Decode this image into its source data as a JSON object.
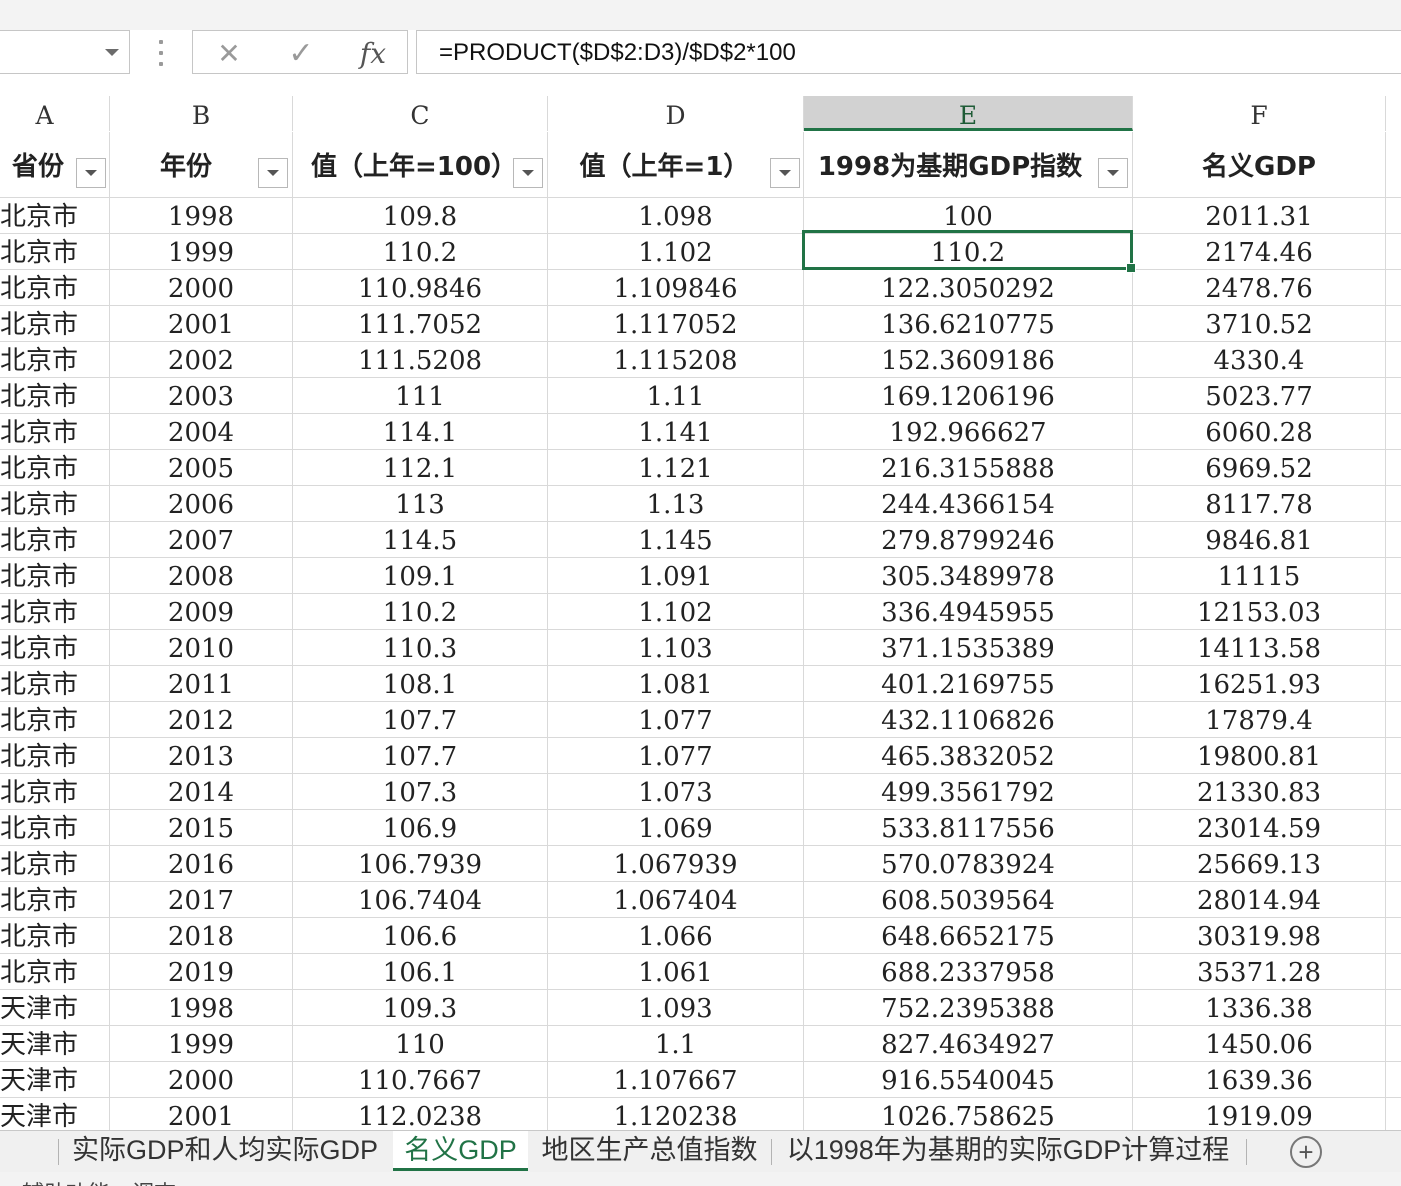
{
  "ribbon": {
    "labels": [
      "",
      "",
      "",
      ""
    ]
  },
  "formula_bar": {
    "name_box": "",
    "cancel_icon": "✕",
    "enter_icon": "✓",
    "fx_label": "fx",
    "formula": "=PRODUCT($D$2:D3)/$D$2*100"
  },
  "columns": [
    "A",
    "B",
    "C",
    "D",
    "E",
    "F"
  ],
  "selected_column": "E",
  "headers": [
    "省份",
    "年份",
    "值（上年=100）",
    "值（上年=1）",
    "1998为基期GDP指数",
    "名义GDP"
  ],
  "rows": [
    [
      "北京市",
      "1998",
      "109.8",
      "1.098",
      "100",
      "2011.31"
    ],
    [
      "北京市",
      "1999",
      "110.2",
      "1.102",
      "110.2",
      "2174.46"
    ],
    [
      "北京市",
      "2000",
      "110.9846",
      "1.109846",
      "122.3050292",
      "2478.76"
    ],
    [
      "北京市",
      "2001",
      "111.7052",
      "1.117052",
      "136.6210775",
      "3710.52"
    ],
    [
      "北京市",
      "2002",
      "111.5208",
      "1.115208",
      "152.3609186",
      "4330.4"
    ],
    [
      "北京市",
      "2003",
      "111",
      "1.11",
      "169.1206196",
      "5023.77"
    ],
    [
      "北京市",
      "2004",
      "114.1",
      "1.141",
      "192.966627",
      "6060.28"
    ],
    [
      "北京市",
      "2005",
      "112.1",
      "1.121",
      "216.3155888",
      "6969.52"
    ],
    [
      "北京市",
      "2006",
      "113",
      "1.13",
      "244.4366154",
      "8117.78"
    ],
    [
      "北京市",
      "2007",
      "114.5",
      "1.145",
      "279.8799246",
      "9846.81"
    ],
    [
      "北京市",
      "2008",
      "109.1",
      "1.091",
      "305.3489978",
      "11115"
    ],
    [
      "北京市",
      "2009",
      "110.2",
      "1.102",
      "336.4945955",
      "12153.03"
    ],
    [
      "北京市",
      "2010",
      "110.3",
      "1.103",
      "371.1535389",
      "14113.58"
    ],
    [
      "北京市",
      "2011",
      "108.1",
      "1.081",
      "401.2169755",
      "16251.93"
    ],
    [
      "北京市",
      "2012",
      "107.7",
      "1.077",
      "432.1106826",
      "17879.4"
    ],
    [
      "北京市",
      "2013",
      "107.7",
      "1.077",
      "465.3832052",
      "19800.81"
    ],
    [
      "北京市",
      "2014",
      "107.3",
      "1.073",
      "499.3561792",
      "21330.83"
    ],
    [
      "北京市",
      "2015",
      "106.9",
      "1.069",
      "533.8117556",
      "23014.59"
    ],
    [
      "北京市",
      "2016",
      "106.7939",
      "1.067939",
      "570.0783924",
      "25669.13"
    ],
    [
      "北京市",
      "2017",
      "106.7404",
      "1.067404",
      "608.5039564",
      "28014.94"
    ],
    [
      "北京市",
      "2018",
      "106.6",
      "1.066",
      "648.6652175",
      "30319.98"
    ],
    [
      "北京市",
      "2019",
      "106.1",
      "1.061",
      "688.2337958",
      "35371.28"
    ],
    [
      "天津市",
      "1998",
      "109.3",
      "1.093",
      "752.2395388",
      "1336.38"
    ],
    [
      "天津市",
      "1999",
      "110",
      "1.1",
      "827.4634927",
      "1450.06"
    ],
    [
      "天津市",
      "2000",
      "110.7667",
      "1.107667",
      "916.5540045",
      "1639.36"
    ],
    [
      "天津市",
      "2001",
      "112.0238",
      "1.120238",
      "1026.758625",
      "1919.09"
    ]
  ],
  "active_cell": {
    "ref": "E3",
    "value": "110.2"
  },
  "sheet_tabs": [
    {
      "label": "实际GDP和人均实际GDP",
      "active": false
    },
    {
      "label": "名义GDP",
      "active": true
    },
    {
      "label": "地区生产总值指数",
      "active": false
    },
    {
      "label": "以1998年为基期的实际GDP计算过程",
      "active": false
    }
  ],
  "add_sheet_icon": "+",
  "status": {
    "text": "辅助功能：调查"
  },
  "colors": {
    "accent": "#217346",
    "grid": "#d9d9d9",
    "header_selected": "#d2d2d2"
  }
}
